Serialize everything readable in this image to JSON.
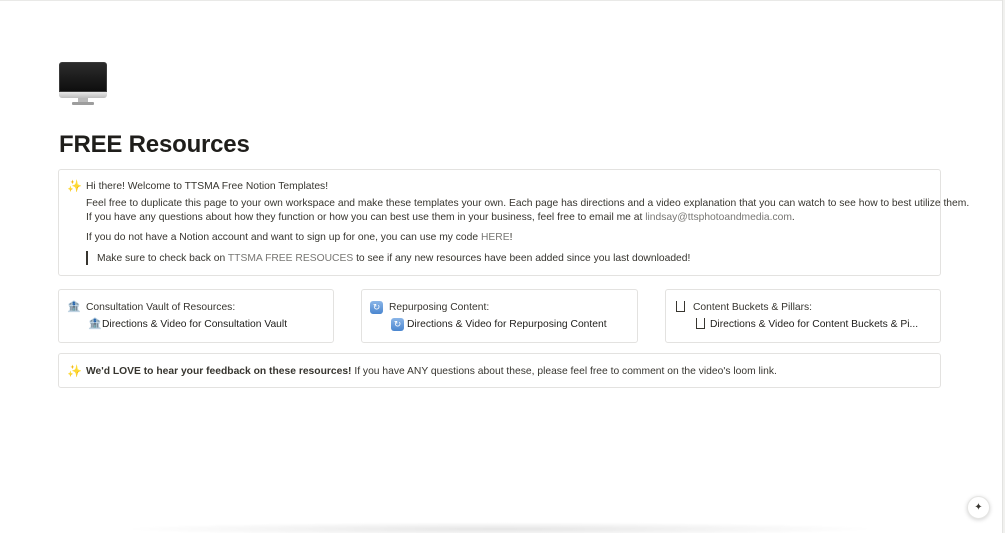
{
  "page": {
    "icon": "imac-icon",
    "title": "FREE Resources"
  },
  "welcome": {
    "icon": "sparkles-icon",
    "greeting": "Hi there! Welcome to TTSMA Free Notion Templates!",
    "line1": "Feel free to duplicate this page to your own workspace and make these templates your own. Each page has directions and a video explanation that you can watch to see how to best utilize them.",
    "line2_prefix": "If you have any questions about how they function or how you can best use them in your business, feel free to email me at ",
    "email": "lindsay@ttsphotoandmedia.com",
    "line2_suffix": ".",
    "line3_prefix": "If you do not have a Notion account and want to sign up for one, you can use my code ",
    "here_link": "HERE",
    "line3_suffix": "!",
    "quote_prefix": "Make sure to check back on ",
    "quote_link": "TTSMA FREE RESOUCES",
    "quote_suffix": " to see if any new resources have been added since you last downloaded!"
  },
  "cards": [
    {
      "icon": "bank-icon",
      "title": "Consultation Vault of Resources:",
      "link_icon": "bank-icon",
      "link": "Directions & Video for Consultation Vault"
    },
    {
      "icon": "repeat-icon",
      "title": "Repurposing Content:",
      "link_icon": "repeat-icon",
      "link": "Directions & Video for Repurposing Content"
    },
    {
      "icon": "box-icon",
      "title": "Content Buckets & Pillars:",
      "link_icon": "box-icon",
      "link": "Directions & Video for Content Buckets & Pi..."
    }
  ],
  "feedback": {
    "icon": "sparkles-icon",
    "bold": "We'd LOVE to hear your feedback on these resources!",
    "rest": " If you have ANY questions about these, please feel free to comment on the video's loom link."
  },
  "help_button": {
    "icon": "sparkle-help-icon",
    "glyph": "✦"
  },
  "colors": {
    "text": "#37352f",
    "link_muted": "#787774",
    "border": "#e3e2e0"
  }
}
